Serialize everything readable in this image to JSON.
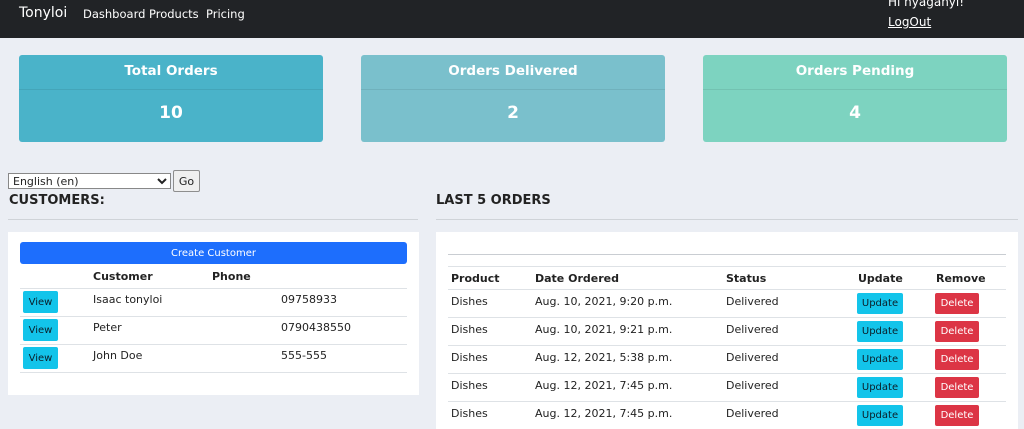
{
  "navbar": {
    "brand": "Tonyloi",
    "links": [
      "Dashboard",
      "Products",
      "Pricing"
    ],
    "greeting": "Hi nyaganyi!",
    "logout": "LogOut"
  },
  "stats": [
    {
      "label": "Total Orders",
      "value": "10",
      "color": "#4ab3c9"
    },
    {
      "label": "Orders Delivered",
      "value": "2",
      "color": "#7ac0cc"
    },
    {
      "label": "Orders Pending",
      "value": "4",
      "color": "#7dd3c0"
    }
  ],
  "language": {
    "selected": "English (en)",
    "go_label": "Go"
  },
  "customers": {
    "title": "CUSTOMERS:",
    "create_label": "Create Customer",
    "headers": [
      "Customer",
      "Phone"
    ],
    "view_label": "View",
    "rows": [
      {
        "name": "Isaac tonyloi",
        "phone": "09758933"
      },
      {
        "name": "Peter",
        "phone": "0790438550"
      },
      {
        "name": "John Doe",
        "phone": "555-555"
      }
    ]
  },
  "orders": {
    "title": "LAST 5 ORDERS",
    "headers": [
      "Product",
      "Date Ordered",
      "Status",
      "Update",
      "Remove"
    ],
    "update_label": "Update",
    "delete_label": "Delete",
    "rows": [
      {
        "product": "Dishes",
        "date": "Aug. 10, 2021, 9:20 p.m.",
        "status": "Delivered"
      },
      {
        "product": "Dishes",
        "date": "Aug. 10, 2021, 9:21 p.m.",
        "status": "Delivered"
      },
      {
        "product": "Dishes",
        "date": "Aug. 12, 2021, 5:38 p.m.",
        "status": "Delivered"
      },
      {
        "product": "Dishes",
        "date": "Aug. 12, 2021, 7:45 p.m.",
        "status": "Delivered"
      },
      {
        "product": "Dishes",
        "date": "Aug. 12, 2021, 7:45 p.m.",
        "status": "Delivered"
      }
    ]
  }
}
